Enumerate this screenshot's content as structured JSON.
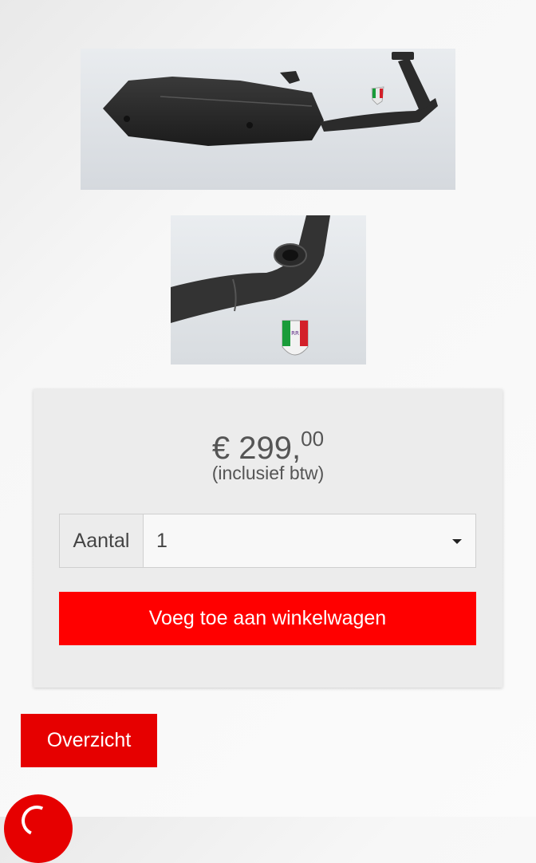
{
  "product": {
    "images": [
      {
        "name": "product-photo-exhaust"
      },
      {
        "name": "product-photo-exhaust-detail"
      }
    ]
  },
  "price": {
    "currency": "€",
    "whole": "299,",
    "cents": "00",
    "vat_note": "(inclusief btw)"
  },
  "quantity": {
    "label": "Aantal",
    "selected": "1"
  },
  "actions": {
    "add_to_cart": "Voeg toe aan winkelwagen",
    "overview": "Overzicht"
  },
  "colors": {
    "accent": "#ff0000",
    "box": "#ececec"
  }
}
